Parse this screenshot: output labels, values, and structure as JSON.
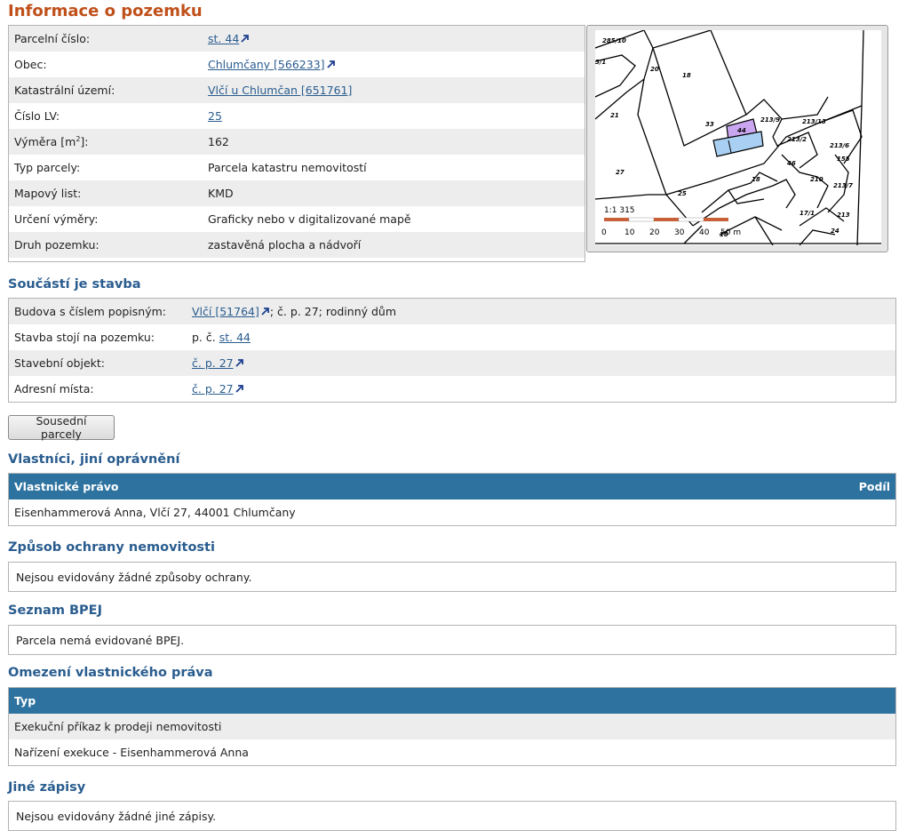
{
  "title": "Informace o pozemku",
  "parcel": {
    "rows": [
      {
        "label": "Parcelní číslo:",
        "link": "st. 44",
        "ext": true
      },
      {
        "label": "Obec:",
        "link": "Chlumčany [566233]",
        "ext": true
      },
      {
        "label": "Katastrální území:",
        "link": "Vlčí u Chlumčan [651761]",
        "ext": false
      },
      {
        "label": "Číslo LV:",
        "link": "25",
        "ext": false
      },
      {
        "label_pre": "Výměra [m",
        "label_sup": "2",
        "label_post": "]:",
        "value": "162"
      },
      {
        "label": "Typ parcely:",
        "value": "Parcela katastru nemovitostí"
      },
      {
        "label": "Mapový list:",
        "value": "KMD"
      },
      {
        "label": "Určení výměry:",
        "value": "Graficky nebo v digitalizované mapě"
      },
      {
        "label": "Druh pozemku:",
        "value": "zastavěná plocha a nádvoří"
      }
    ]
  },
  "map": {
    "scale_label": "1:1 315",
    "scale_ticks": [
      "0",
      "10",
      "20",
      "30",
      "40",
      "50 m"
    ],
    "labels": [
      "285/10",
      "3/1",
      "20",
      "18",
      "21",
      "33",
      "44",
      "213/9",
      "213/13",
      "213/2",
      "46",
      "213/6",
      "155",
      "27",
      "18",
      "210",
      "213/7",
      "17/1",
      "213",
      "24",
      "18",
      "25"
    ]
  },
  "building": {
    "heading": "Součástí je stavba",
    "rows": [
      {
        "label": "Budova s číslem popisným:",
        "link": "Vlčí [51764]",
        "ext": true,
        "suffix": "; č. p. 27; rodinný dům"
      },
      {
        "label": "Stavba stojí na pozemku:",
        "prefix": "p. č. ",
        "link": "st. 44",
        "ext": false
      },
      {
        "label": "Stavební objekt:",
        "link": "č. p. 27",
        "ext": true
      },
      {
        "label": "Adresní místa:",
        "link": "č. p. 27",
        "ext": true
      }
    ]
  },
  "neighbors_button": "Sousední parcely",
  "owners": {
    "heading": "Vlastníci, jiní oprávnění",
    "col_left": "Vlastnické právo",
    "col_right": "Podíl",
    "rows": [
      "Eisenhammerová Anna, Vlčí 27, 44001 Chlumčany"
    ]
  },
  "protection": {
    "heading": "Způsob ochrany nemovitosti",
    "text": "Nejsou evidovány žádné způsoby ochrany."
  },
  "bpej": {
    "heading": "Seznam BPEJ",
    "text": "Parcela nemá evidované BPEJ."
  },
  "restrictions": {
    "heading": "Omezení vlastnického práva",
    "col": "Typ",
    "rows": [
      "Exekuční příkaz k prodeji nemovitosti",
      "Nařízení exekuce - Eisenhammerová Anna"
    ]
  },
  "other": {
    "heading": "Jiné zápisy",
    "text": "Nejsou evidovány žádné jiné zápisy."
  },
  "colors": {
    "heading_orange": "#c0501a",
    "heading_blue": "#2a5d8f",
    "table_header": "#2e73a0",
    "row_alt": "#ededed",
    "parcel_highlight": "#c9a6ef",
    "building_highlight": "#a9d0f2"
  }
}
